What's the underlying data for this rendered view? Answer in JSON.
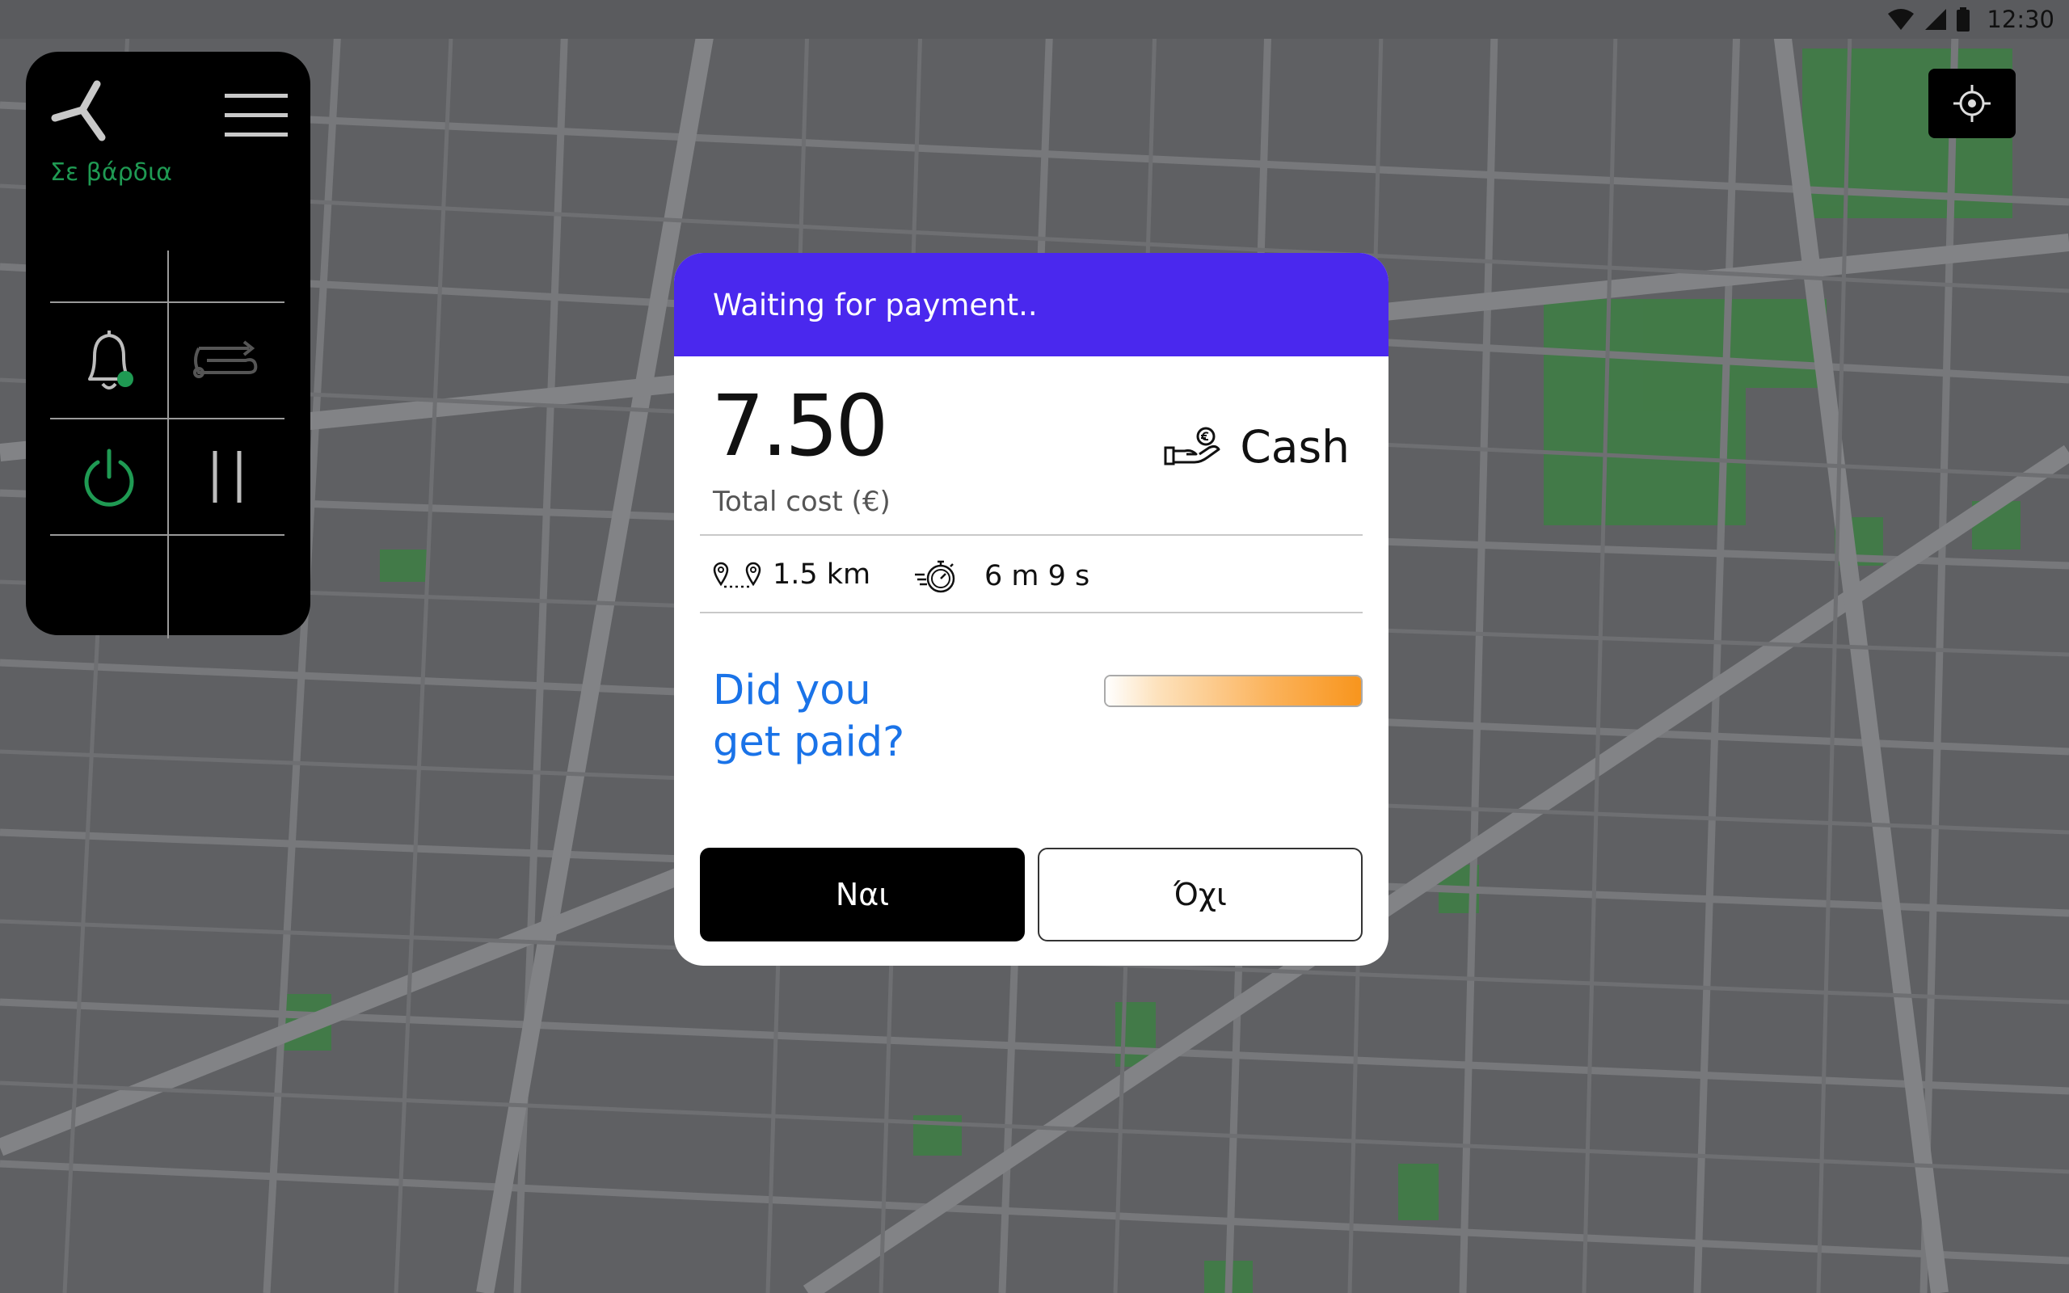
{
  "status_bar": {
    "time": "12:30",
    "icons": [
      "wifi-icon",
      "signal-icon",
      "battery-icon"
    ]
  },
  "side_panel": {
    "shift_status": "Σε βάρδια",
    "icons": [
      "logo-icon",
      "menu-icon",
      "bell-icon",
      "route-icon",
      "power-icon",
      "pause-icon"
    ],
    "colors": {
      "active": "#1f9a53",
      "inactive": "#555555"
    }
  },
  "map": {
    "background": "#5f6063",
    "roads": "#7a7b7e",
    "parks": "#3f7d45"
  },
  "modal": {
    "header": "Waiting for payment..",
    "header_color": "#4a28ee",
    "cost": "7.50",
    "cost_label": "Total cost (€)",
    "payment_method": "Cash",
    "distance": "1.5 km",
    "duration": "6 m 9 s",
    "question_line1": "Did you",
    "question_line2": "get paid?",
    "question_color": "#1a73e8",
    "progress": 1.0,
    "yes_label": "Ναι",
    "no_label": "Όχι"
  }
}
